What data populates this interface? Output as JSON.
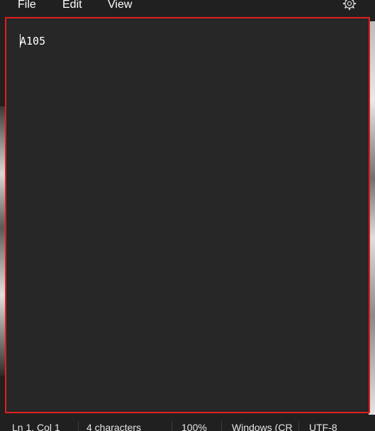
{
  "menu": {
    "file": "File",
    "edit": "Edit",
    "view": "View",
    "settings_icon": "gear-icon"
  },
  "editor": {
    "content": "A105"
  },
  "status": {
    "position": "Ln 1, Col 1",
    "characters": "4 characters",
    "zoom": "100%",
    "line_ending": "Windows (CR",
    "encoding": "UTF-8"
  },
  "colors": {
    "background": "#202020",
    "editor_background": "#272727",
    "focus_border": "#e01e1e",
    "text": "#ffffff"
  }
}
